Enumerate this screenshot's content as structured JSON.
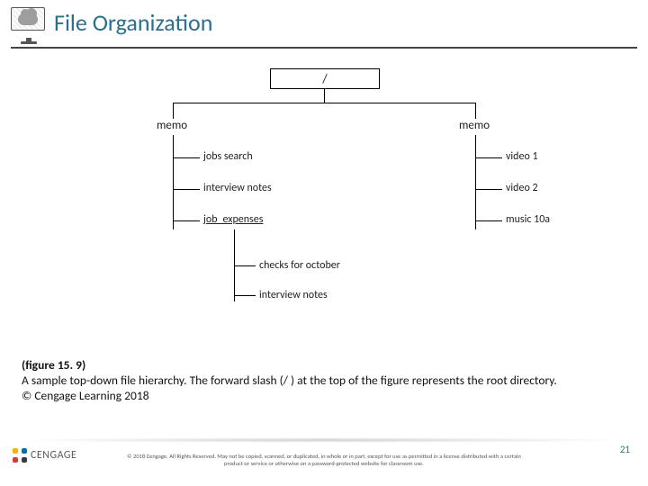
{
  "title": "File Organization",
  "tree": {
    "root": "/",
    "left": {
      "label": "memo",
      "children": {
        "c0": "jobs search",
        "c1": "interview notes",
        "c2": "job_expenses",
        "c2_children": {
          "g0": "checks for october",
          "g1": "interview notes"
        }
      }
    },
    "right": {
      "label": "memo",
      "children": {
        "c0": "video 1",
        "c1": "video 2",
        "c2": "music 10a"
      }
    }
  },
  "caption": {
    "figure": "(figure 15. 9)",
    "line1": "A sample top-down file hierarchy. The forward slash (/ ) at the top of the figure represents the root directory.",
    "line2": "© Cengage Learning 2018"
  },
  "logo_text": "CENGAGE",
  "copyright": "© 2018 Cengage. All Rights Reserved. May not be copied, scanned, or duplicated, in whole or in part, except for use as permitted in a license distributed with a certain product or service or otherwise on a password-protected website for classroom use.",
  "page_number": "21"
}
